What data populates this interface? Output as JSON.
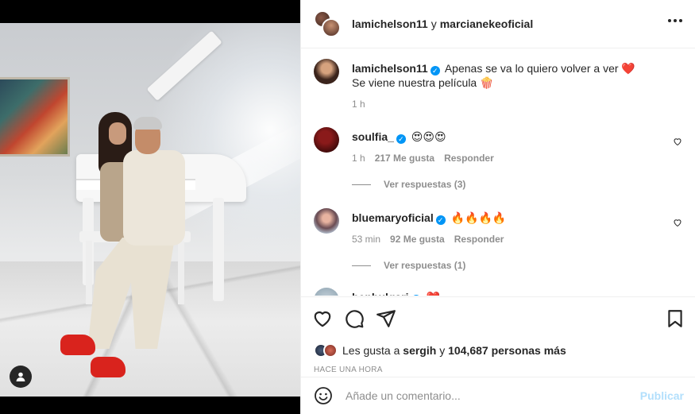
{
  "header": {
    "user1": "lamichelson11",
    "conjunction": "y",
    "user2": "marcianekeoficial",
    "more_icon": "ellipsis-icon"
  },
  "caption": {
    "user": "lamichelson11",
    "line1": "Apenas se va lo quiero volver a ver ❤️",
    "line2": "Se viene nuestra película 🍿",
    "time": "1 h"
  },
  "comments": [
    {
      "user": "soulfia_",
      "text": "😍😍😍",
      "time": "1 h",
      "likes": "217 Me gusta",
      "reply": "Responder",
      "view_replies": "Ver respuestas (3)"
    },
    {
      "user": "bluemaryoficial",
      "text": "🔥🔥🔥🔥",
      "time": "53 min",
      "likes": "92 Me gusta",
      "reply": "Responder",
      "view_replies": "Ver respuestas (1)"
    },
    {
      "user": "benbulgari",
      "text": "❤️"
    }
  ],
  "likes": {
    "prefix": "Les gusta a",
    "user": "sergih",
    "conjunction": "y",
    "others": "104,687 personas más"
  },
  "time_ago": "Hace una hora",
  "add_comment": {
    "placeholder": "Añade un comentario...",
    "post_label": "Publicar"
  },
  "colors": {
    "verified": "#0095f6",
    "post_disabled": "#b2dffc",
    "secondary_text": "#8e8e8e"
  }
}
